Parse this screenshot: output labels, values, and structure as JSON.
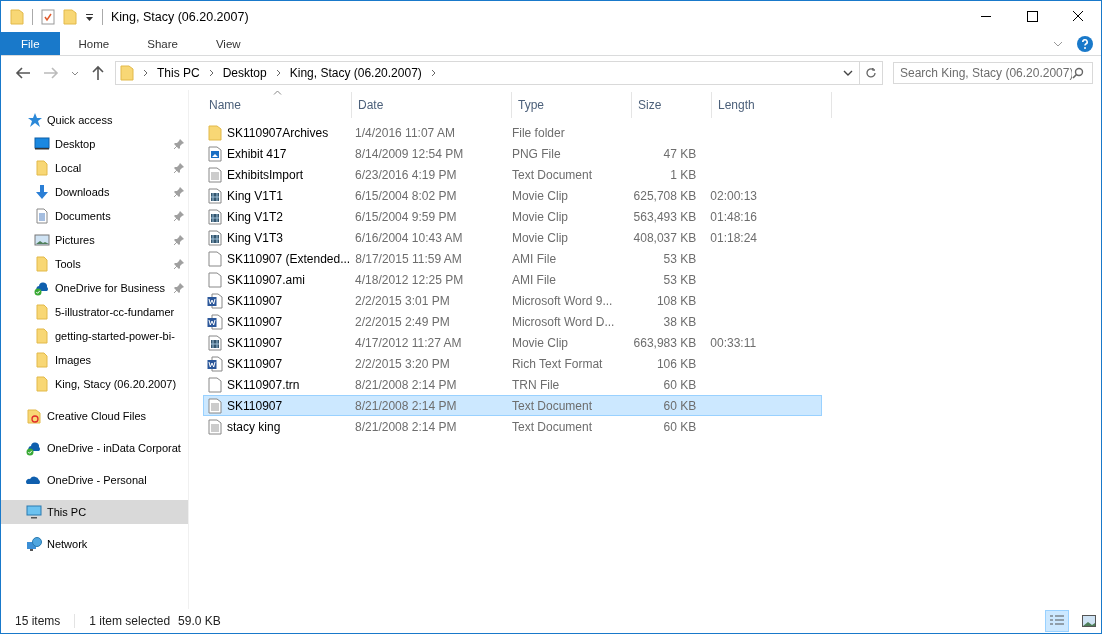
{
  "window": {
    "title": "King, Stacy (06.20.2007)"
  },
  "ribbon_tabs": [
    {
      "label": "File",
      "selected": true
    },
    {
      "label": "Home",
      "selected": false
    },
    {
      "label": "Share",
      "selected": false
    },
    {
      "label": "View",
      "selected": false
    }
  ],
  "address": {
    "crumbs": [
      "This PC",
      "Desktop",
      "King, Stacy (06.20.2007)"
    ]
  },
  "search": {
    "placeholder": "Search King, Stacy (06.20.2007)"
  },
  "sidebar": {
    "items": [
      {
        "label": "Quick access",
        "kind": "star",
        "selected": false,
        "children": [
          {
            "label": "Desktop",
            "kind": "desktop",
            "pinned": true,
            "selected": false
          },
          {
            "label": "Local",
            "kind": "folder",
            "pinned": true,
            "selected": false
          },
          {
            "label": "Downloads",
            "kind": "download",
            "pinned": true,
            "selected": false
          },
          {
            "label": "Documents",
            "kind": "document",
            "pinned": true,
            "selected": false
          },
          {
            "label": "Pictures",
            "kind": "picture",
            "pinned": true,
            "selected": false
          },
          {
            "label": "Tools",
            "kind": "folder",
            "pinned": true,
            "selected": false
          },
          {
            "label": "OneDrive for Business",
            "kind": "cloud-check",
            "pinned": true,
            "selected": false
          },
          {
            "label": "5-illustrator-cc-fundamer",
            "kind": "folder",
            "pinned": false,
            "selected": false
          },
          {
            "label": "getting-started-power-bi-",
            "kind": "folder",
            "pinned": false,
            "selected": false
          },
          {
            "label": "Images",
            "kind": "folder",
            "pinned": false,
            "selected": false
          },
          {
            "label": "King, Stacy (06.20.2007)",
            "kind": "folder",
            "pinned": false,
            "selected": false
          }
        ]
      },
      {
        "label": "Creative Cloud Files",
        "kind": "cc-folder",
        "selected": false
      },
      {
        "label": "OneDrive - inData Corporat",
        "kind": "cloud-check",
        "selected": false
      },
      {
        "label": "OneDrive - Personal",
        "kind": "cloud",
        "selected": false
      },
      {
        "label": "This PC",
        "kind": "pc",
        "selected": true
      },
      {
        "label": "Network",
        "kind": "network",
        "selected": false
      }
    ]
  },
  "table": {
    "columns": [
      "Name",
      "Date",
      "Type",
      "Size",
      "Length"
    ],
    "rows": [
      {
        "kind": "folder",
        "name": "SK110907Archives",
        "date": "1/4/2016 11:07 AM",
        "type": "File folder",
        "size": "",
        "length": "",
        "selected": false
      },
      {
        "kind": "image",
        "name": "Exhibit 417",
        "date": "8/14/2009 12:54 PM",
        "type": "PNG File",
        "size": "47 KB",
        "length": "",
        "selected": false
      },
      {
        "kind": "text",
        "name": "ExhibitsImport",
        "date": "6/23/2016 4:19 PM",
        "type": "Text Document",
        "size": "1 KB",
        "length": "",
        "selected": false
      },
      {
        "kind": "movie",
        "name": "King V1T1",
        "date": "6/15/2004 8:02 PM",
        "type": "Movie Clip",
        "size": "625,708 KB",
        "length": "02:00:13",
        "selected": false
      },
      {
        "kind": "movie",
        "name": "King V1T2",
        "date": "6/15/2004 9:59 PM",
        "type": "Movie Clip",
        "size": "563,493 KB",
        "length": "01:48:16",
        "selected": false
      },
      {
        "kind": "movie",
        "name": "King V1T3",
        "date": "6/16/2004 10:43 AM",
        "type": "Movie Clip",
        "size": "408,037 KB",
        "length": "01:18:24",
        "selected": false
      },
      {
        "kind": "blank",
        "name": "SK110907 (Extended...",
        "date": "8/17/2015 11:59 AM",
        "type": "AMI File",
        "size": "53 KB",
        "length": "",
        "selected": false
      },
      {
        "kind": "blank",
        "name": "SK110907.ami",
        "date": "4/18/2012 12:25 PM",
        "type": "AMI File",
        "size": "53 KB",
        "length": "",
        "selected": false
      },
      {
        "kind": "word",
        "name": "SK110907",
        "date": "2/2/2015 3:01 PM",
        "type": "Microsoft Word 9...",
        "size": "108 KB",
        "length": "",
        "selected": false
      },
      {
        "kind": "word",
        "name": "SK110907",
        "date": "2/2/2015 2:49 PM",
        "type": "Microsoft Word D...",
        "size": "38 KB",
        "length": "",
        "selected": false
      },
      {
        "kind": "movie",
        "name": "SK110907",
        "date": "4/17/2012 11:27 AM",
        "type": "Movie Clip",
        "size": "663,983 KB",
        "length": "00:33:11",
        "selected": false
      },
      {
        "kind": "word",
        "name": "SK110907",
        "date": "2/2/2015 3:20 PM",
        "type": "Rich Text Format",
        "size": "106 KB",
        "length": "",
        "selected": false
      },
      {
        "kind": "blank",
        "name": "SK110907.trn",
        "date": "8/21/2008 2:14 PM",
        "type": "TRN File",
        "size": "60 KB",
        "length": "",
        "selected": false
      },
      {
        "kind": "text",
        "name": "SK110907",
        "date": "8/21/2008 2:14 PM",
        "type": "Text Document",
        "size": "60 KB",
        "length": "",
        "selected": true
      },
      {
        "kind": "text",
        "name": "stacy king",
        "date": "8/21/2008 2:14 PM",
        "type": "Text Document",
        "size": "60 KB",
        "length": "",
        "selected": false
      }
    ]
  },
  "status_bar": {
    "count": "15 items",
    "selection": "1 item selected",
    "selection_size": "59.0 KB"
  }
}
